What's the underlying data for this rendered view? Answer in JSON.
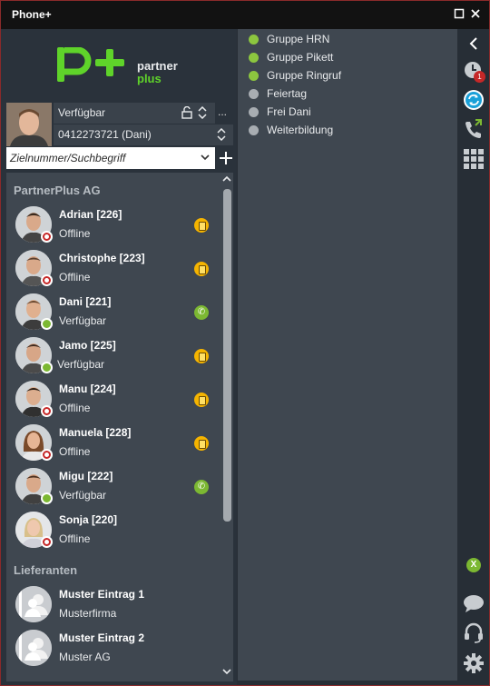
{
  "window": {
    "title": "Phone+"
  },
  "logo": {
    "line1": "partner",
    "line2": "plus"
  },
  "me": {
    "status": "Verfügbar",
    "number": "0412273721 (Dani)",
    "more": "..."
  },
  "search": {
    "placeholder": "Zielnummer/Suchbegriff"
  },
  "groups": [
    {
      "title": "PartnerPlus AG",
      "contacts": [
        {
          "name": "Adrian [226]",
          "status": "Offline",
          "presence": "offline",
          "device": "desk"
        },
        {
          "name": "Christophe [223]",
          "status": "Offline",
          "presence": "offline",
          "device": "desk"
        },
        {
          "name": "Dani [221]",
          "status": "Verfügbar",
          "presence": "available",
          "device": "phone"
        },
        {
          "name": "Jamo [225]",
          "status": "Verfügbar",
          "presence": "available",
          "device": "desk"
        },
        {
          "name": "Manu [224]",
          "status": "Offline",
          "presence": "offline",
          "device": "desk"
        },
        {
          "name": "Manuela [228]",
          "status": "Offline",
          "presence": "offline",
          "device": "desk"
        },
        {
          "name": "Migu [222]",
          "status": "Verfügbar",
          "presence": "available",
          "device": "phone"
        },
        {
          "name": "Sonja [220]",
          "status": "Offline",
          "presence": "offline",
          "device": "none"
        }
      ]
    },
    {
      "title": "Lieferanten",
      "contacts": [
        {
          "name": "Muster Eintrag 1",
          "status": "Musterfirma"
        },
        {
          "name": "Muster Eintrag 2",
          "status": "Muster AG"
        }
      ]
    }
  ],
  "call_groups": [
    {
      "label": "Gruppe HRN",
      "active": true
    },
    {
      "label": "Gruppe Pikett",
      "active": true
    },
    {
      "label": "Gruppe Ringruf",
      "active": true
    },
    {
      "label": "Feiertag",
      "active": false
    },
    {
      "label": "Frei Dani",
      "active": false
    },
    {
      "label": "Weiterbildung",
      "active": false
    }
  ],
  "sidebar": {
    "history_badge": "1",
    "excel_label": "X"
  },
  "colors": {
    "available": "#7cb832",
    "offline": "#c62828",
    "desk_phone": "#f5b400",
    "accent_blue": "#1aa0d8"
  }
}
